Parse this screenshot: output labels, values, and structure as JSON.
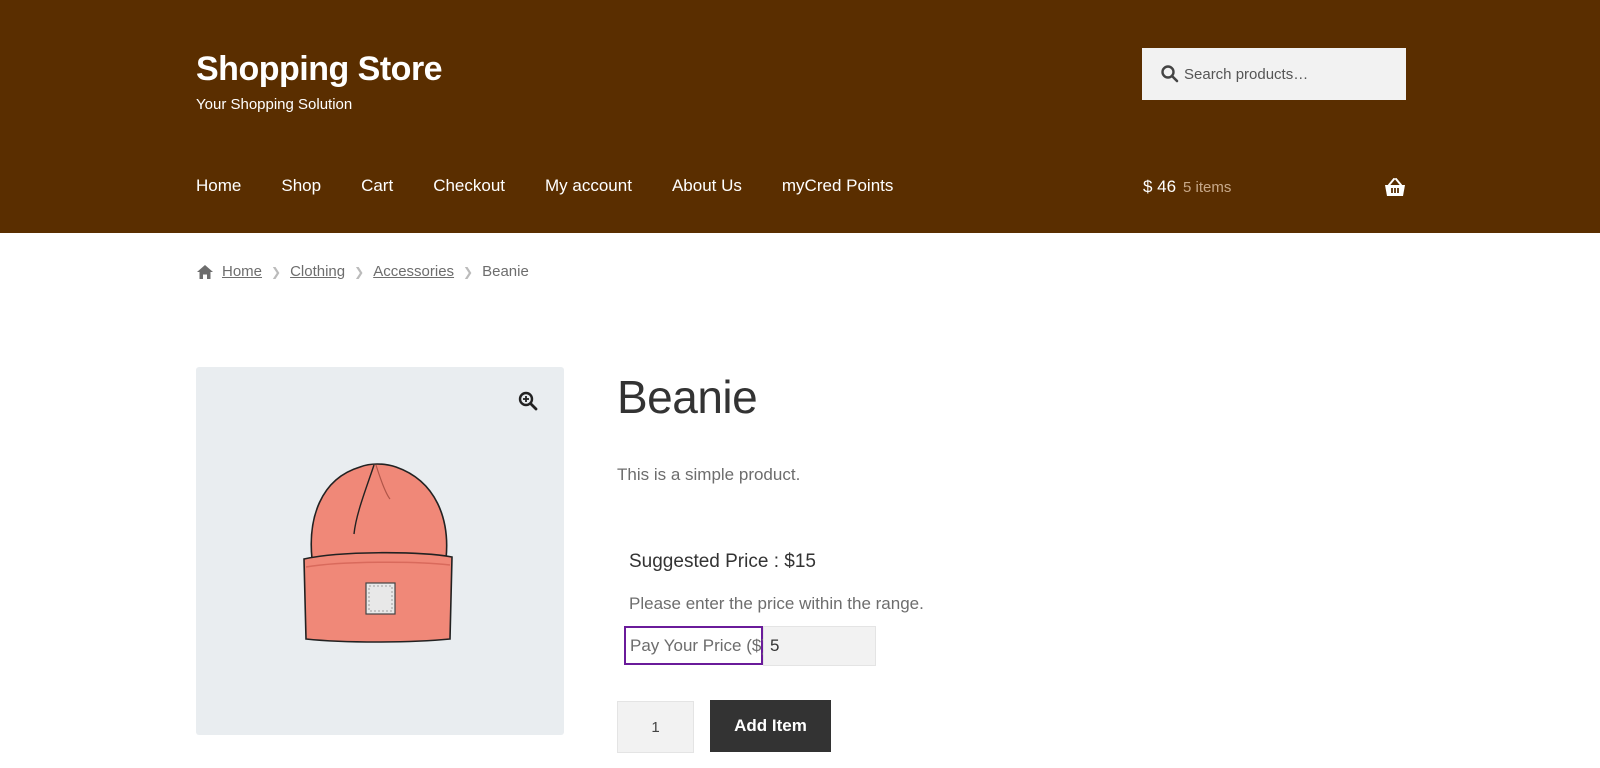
{
  "header": {
    "site_title": "Shopping Store",
    "tagline": "Your Shopping Solution",
    "search": {
      "placeholder": "Search products…"
    },
    "nav": [
      {
        "label": "Home"
      },
      {
        "label": "Shop"
      },
      {
        "label": "Cart"
      },
      {
        "label": "Checkout"
      },
      {
        "label": "My account"
      },
      {
        "label": "About Us"
      },
      {
        "label": "myCred Points"
      }
    ],
    "cart": {
      "amount": "$ 46",
      "count": "5 items"
    }
  },
  "breadcrumb": {
    "items": [
      {
        "label": "Home"
      },
      {
        "label": "Clothing"
      },
      {
        "label": "Accessories"
      }
    ],
    "current": "Beanie"
  },
  "product": {
    "title": "Beanie",
    "description": "This is a simple product.",
    "suggested_price": "Suggested Price : $15",
    "range_note": "Please enter the price within the range.",
    "pay_label": "Pay Your Price ($)",
    "pay_value": "5",
    "quantity": "1",
    "add_button": "Add Item"
  },
  "colors": {
    "header_bg": "#5a2e00",
    "focus_outline": "#6a1b9a",
    "button_bg": "#333333",
    "gallery_bg": "#e9edf0",
    "beanie": "#f08878"
  },
  "icons": [
    "search-icon",
    "basket-icon",
    "home-icon",
    "chevron-right-icon",
    "zoom-icon"
  ]
}
